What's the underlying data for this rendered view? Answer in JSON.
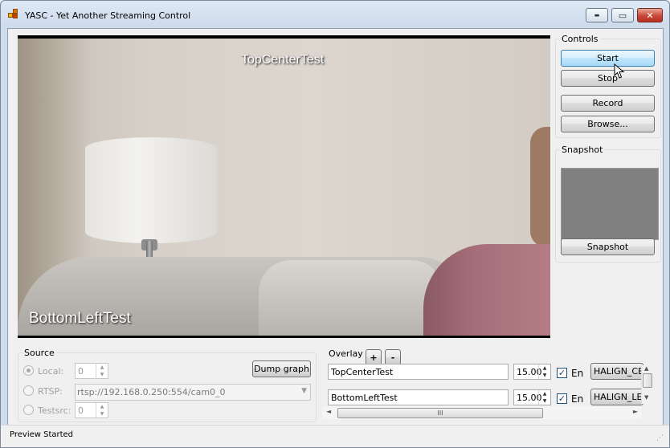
{
  "window": {
    "title": "YASC - Yet Another Streaming Control",
    "min_glyph": "▬",
    "max_glyph": "▭",
    "close_glyph": "✕"
  },
  "video": {
    "overlay_top_text": "TopCenterTest",
    "overlay_bottom_text": "BottomLeftTest"
  },
  "controls": {
    "group_label": "Controls",
    "start_label": "Start",
    "stop_label": "Stop",
    "record_label": "Record",
    "browse_label": "Browse..."
  },
  "snapshot": {
    "group_label": "Snapshot",
    "button_label": "Snapshot"
  },
  "source": {
    "group_label": "Source",
    "local_label": "Local:",
    "local_value": "0",
    "local_selected": true,
    "rtsp_label": "RTSP:",
    "rtsp_value": "rtsp://192.168.0.250:554/cam0_0",
    "testsrc_label": "Testsrc:",
    "testsrc_value": "0",
    "dump_graph_label": "Dump graph"
  },
  "overlay": {
    "group_label": "Overlay",
    "add_label": "+",
    "remove_label": "-",
    "rows": [
      {
        "text": "TopCenterTest",
        "size": "15.00",
        "enabled": true,
        "en_label": "En",
        "halign": "HALIGN_CE"
      },
      {
        "text": "BottomLeftTest",
        "size": "15.00",
        "enabled": true,
        "en_label": "En",
        "halign": "HALIGN_LE"
      }
    ],
    "hscroll_grip": "III"
  },
  "status": {
    "text": "Preview Started"
  },
  "icons": {
    "spin_up": "▲",
    "spin_down": "▼",
    "combo_arrow": "▼",
    "scroll_left": "◄",
    "scroll_right": "►",
    "scroll_up": "▲",
    "scroll_down": "▼",
    "check": "✓",
    "grip": "⋰"
  }
}
